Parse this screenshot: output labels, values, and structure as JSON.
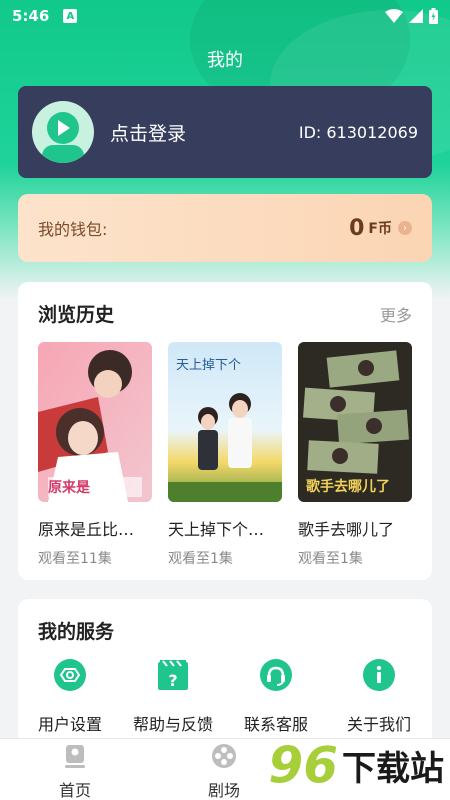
{
  "status": {
    "time": "5:46",
    "a_badge": "A"
  },
  "header": {
    "title": "我的"
  },
  "login": {
    "prompt": "点击登录",
    "id_text": "ID: 613012069"
  },
  "wallet": {
    "label": "我的钱包:",
    "amount": "0",
    "unit": "F币"
  },
  "history": {
    "title": "浏览历史",
    "more": "更多",
    "items": [
      {
        "title": "原来是丘比…",
        "progress": "观看至11集",
        "poster_text": "原来是"
      },
      {
        "title": "天上掉下个…",
        "progress": "观看至1集",
        "poster_text": "天上掉下个"
      },
      {
        "title": "歌手去哪儿了",
        "progress": "观看至1集",
        "poster_text": "歌手去哪儿了"
      }
    ]
  },
  "services": {
    "title": "我的服务",
    "items": [
      {
        "label": "用户设置",
        "icon": "settings-icon"
      },
      {
        "label": "帮助与反馈",
        "icon": "help-icon"
      },
      {
        "label": "联系客服",
        "icon": "customer-service-icon"
      },
      {
        "label": "关于我们",
        "icon": "info-icon"
      }
    ]
  },
  "tabbar": {
    "items": [
      {
        "label": "首页",
        "icon": "home-icon"
      },
      {
        "label": "剧场",
        "icon": "theater-icon"
      }
    ]
  },
  "watermark": {
    "number": "96",
    "text": "下载站"
  },
  "colors": {
    "accent": "#1fc58c",
    "login_card": "#373e5d",
    "wallet_bg": "#fbd9bd"
  }
}
